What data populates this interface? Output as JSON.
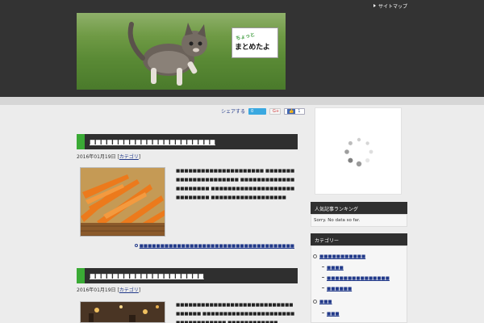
{
  "header": {
    "top_link_label": "サイトマップ",
    "logo_small_text": "ちょっと",
    "logo_big_text": "まとめたよ"
  },
  "share": {
    "label": "シェアする",
    "tweet_count": "0",
    "gplus_label": "G+",
    "fb_count": "1"
  },
  "posts": [
    {
      "title": "■■■■■■■■■■■■■■■■■■■■■■",
      "date": "2016年01月19日",
      "category": "カテゴリ",
      "excerpt": "■■■■■■■■■■■■■■■■■■■■■ ■■■■■■■■■■■■■■■■■■■■■■ ■■■■■■■■■■■■■■■■■■■■■ ■■■■■■■■■■■■■■■■■■■■■■■■■■■■ ■■■■■■■■■■■■■■■■■■",
      "more": "■■■■■■■■■■■■■■■■■■■■■■■■■■■■■■■■■■■■■"
    },
    {
      "title": "■■■■■■■■■■■■■■■■■■■■",
      "date": "2016年01月19日",
      "category": "カテゴリ",
      "excerpt": "■■■■■■■■■■■■■■■■■■■■■■■■■■■■■■■■■■ ■■■■■■■■■■■■■■■■■■■■■■■■■■■■■■■■■■ ■■■■■■■■■■■■"
    }
  ],
  "sidebar": {
    "ranking_title": "人気記事ランキング",
    "ranking_empty": "Sorry. No data so far.",
    "category_title": "カテゴリー",
    "categories": [
      {
        "label": "■■■■■■■■■■■"
      },
      {
        "label": "■■■■"
      },
      {
        "label": "■■■■■■■■■■■■■■■"
      },
      {
        "label": "■■■■■■"
      },
      {
        "label": "■■■"
      },
      {
        "label": "■■■"
      }
    ]
  }
}
